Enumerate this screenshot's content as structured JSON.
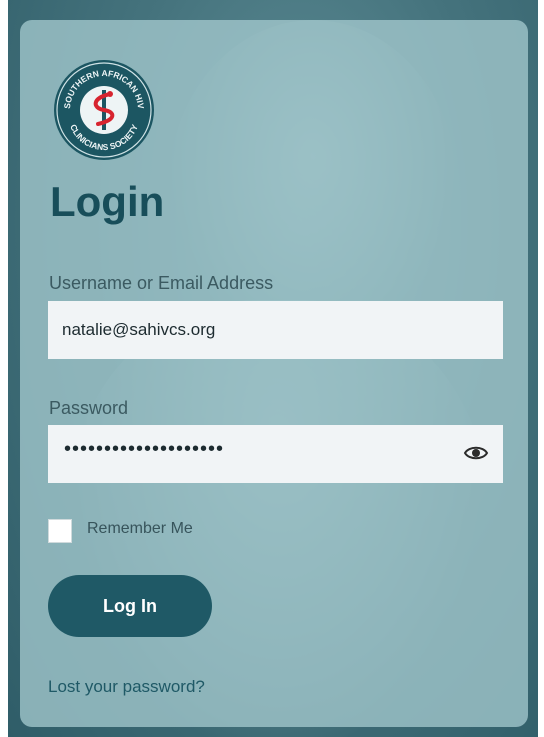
{
  "logo": {
    "arc_text": "SOUTHERN AFRICAN HIV CLINICIANS SOCIETY"
  },
  "title": "Login",
  "username": {
    "label": "Username or Email Address",
    "value": "natalie@sahivcs.org"
  },
  "password": {
    "label": "Password",
    "masked_value": "••••••••••••••••••••",
    "toggle_icon": "eye-icon"
  },
  "remember": {
    "label": "Remember Me",
    "checked": false
  },
  "login_button": {
    "label": "Log In"
  },
  "lost_password": {
    "label": "Lost your password?"
  },
  "colors": {
    "accent": "#1f5966",
    "card": "#a0c6cb",
    "logo_red": "#d7242f"
  }
}
